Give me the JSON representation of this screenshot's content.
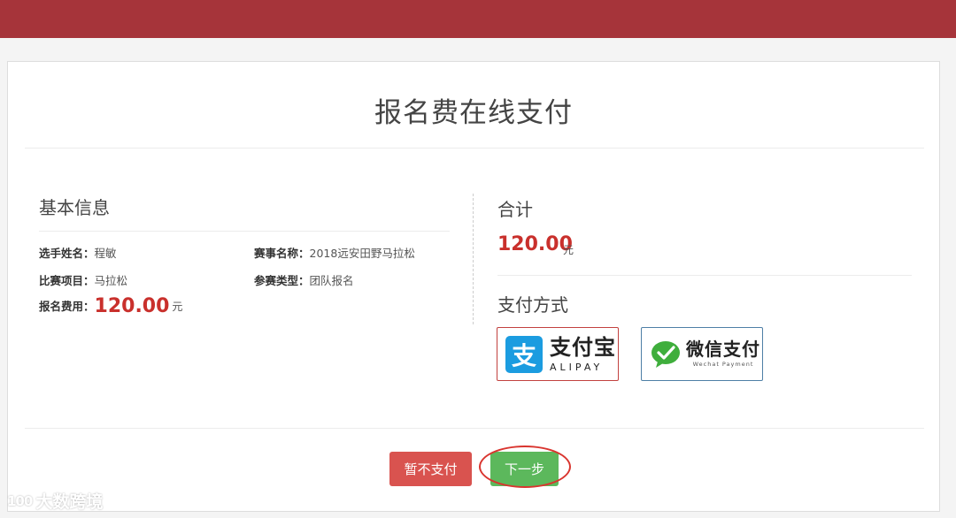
{
  "page_title": "报名费在线支付",
  "basic": {
    "heading": "基本信息",
    "name_label": "选手姓名：",
    "name_value": "程敏",
    "event_label": "赛事名称：",
    "event_value": "2018远安田野马拉松",
    "item_label": "比赛项目：",
    "item_value": "马拉松",
    "type_label": "参赛类型：",
    "type_value": "团队报名",
    "fee_label": "报名费用：",
    "fee_value": "120.00",
    "fee_unit": "元"
  },
  "total": {
    "heading": "合计",
    "amount": "120.00",
    "unit": "元"
  },
  "payment": {
    "heading": "支付方式",
    "alipay": {
      "logo_glyph": "支",
      "cn": "支付宝",
      "en": "ALIPAY",
      "icon": "alipay-logo"
    },
    "wechat": {
      "cn": "微信支付",
      "en": "Wechat  Payment",
      "icon": "wechat-pay-logo"
    }
  },
  "buttons": {
    "later": "暂不支付",
    "next": "下一步"
  },
  "watermark": {
    "glyph": "100",
    "text": "大数跨境"
  },
  "colors": {
    "topbar": "#a6343a",
    "accent_red": "#c9302c",
    "button_red": "#d9534f",
    "button_green": "#5cb85c",
    "alipay_blue": "#1b9ce0",
    "wechat_green": "#3fae3c"
  }
}
